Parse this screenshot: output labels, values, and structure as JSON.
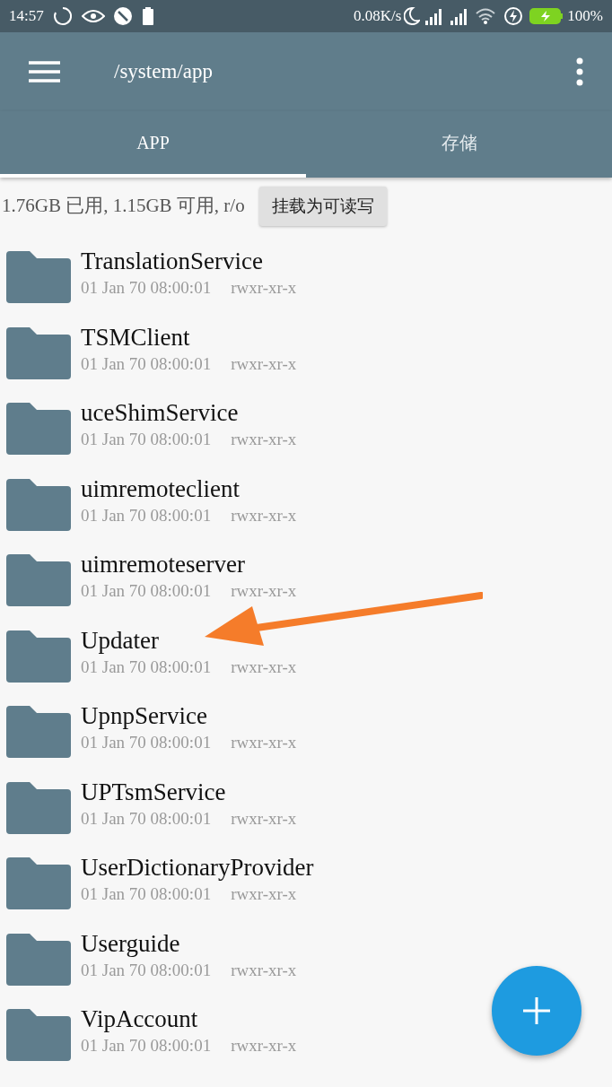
{
  "status_bar": {
    "time": "14:57",
    "net_speed": "0.08K/s",
    "battery": "100%"
  },
  "toolbar": {
    "title": "/system/app"
  },
  "tabs": [
    {
      "label": "APP",
      "selected": true
    },
    {
      "label": "存储",
      "selected": false
    }
  ],
  "storage": {
    "info": "1.76GB 已用, 1.15GB 可用, r/o",
    "button": "挂载为可读写"
  },
  "folders": [
    {
      "name": "TranslationService",
      "date": "01 Jan 70 08:00:01",
      "permissions": "rwxr-xr-x"
    },
    {
      "name": "TSMClient",
      "date": "01 Jan 70 08:00:01",
      "permissions": "rwxr-xr-x"
    },
    {
      "name": "uceShimService",
      "date": "01 Jan 70 08:00:01",
      "permissions": "rwxr-xr-x"
    },
    {
      "name": "uimremoteclient",
      "date": "01 Jan 70 08:00:01",
      "permissions": "rwxr-xr-x"
    },
    {
      "name": "uimremoteserver",
      "date": "01 Jan 70 08:00:01",
      "permissions": "rwxr-xr-x"
    },
    {
      "name": "Updater",
      "date": "01 Jan 70 08:00:01",
      "permissions": "rwxr-xr-x"
    },
    {
      "name": "UpnpService",
      "date": "01 Jan 70 08:00:01",
      "permissions": "rwxr-xr-x"
    },
    {
      "name": "UPTsmService",
      "date": "01 Jan 70 08:00:01",
      "permissions": "rwxr-xr-x"
    },
    {
      "name": "UserDictionaryProvider",
      "date": "01 Jan 70 08:00:01",
      "permissions": "rwxr-xr-x"
    },
    {
      "name": "Userguide",
      "date": "01 Jan 70 08:00:01",
      "permissions": "rwxr-xr-x"
    },
    {
      "name": "VipAccount",
      "date": "01 Jan 70 08:00:01",
      "permissions": "rwxr-xr-x"
    }
  ]
}
